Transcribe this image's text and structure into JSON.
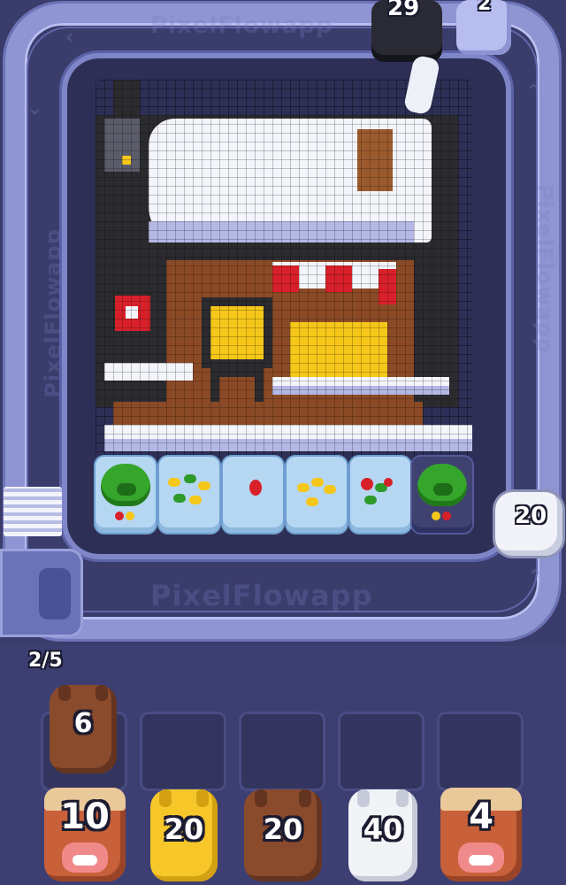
{
  "game": {
    "watermark": "PixelFlowapp",
    "top_counter_left": "29",
    "top_counter_right": "2",
    "track_bunny_count": "20",
    "queue_progress": "2/5",
    "slot_animal_count": "6",
    "bottom_animals": [
      {
        "kind": "bull",
        "count": "10",
        "color": "#c8603a"
      },
      {
        "kind": "bunny",
        "count": "20",
        "color": "#f7c72a"
      },
      {
        "kind": "bunny",
        "count": "20",
        "color": "#8a4a2c"
      },
      {
        "kind": "bunny",
        "count": "40",
        "color": "#f2f3f6"
      },
      {
        "kind": "bull",
        "count": "4",
        "color": "#c8603a"
      }
    ],
    "tiles": [
      "pig-tile",
      "bean-tile",
      "berry-tile",
      "bean-tile",
      "berry-tile",
      "pig-tile"
    ],
    "colors": {
      "background": "#3a3c6c",
      "track": "#8e95d2",
      "board": "#2d2f56",
      "tile": "#b6d7f2",
      "yellow": "#f5c71a",
      "red": "#d8202a",
      "brown": "#8b4a26"
    }
  }
}
